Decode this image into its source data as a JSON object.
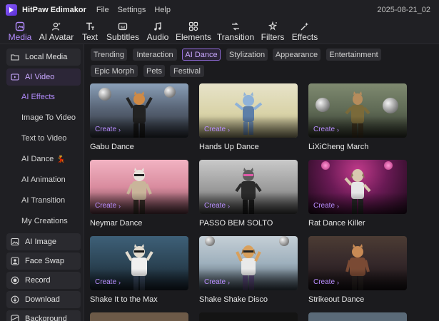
{
  "app": {
    "title": "HitPaw Edimakor",
    "menu": [
      "File",
      "Settings",
      "Help"
    ],
    "date": "2025-08-21_02"
  },
  "tool_tabs": [
    {
      "label": "Media",
      "icon": "media-icon",
      "active": true
    },
    {
      "label": "AI Avatar",
      "icon": "ai-avatar-icon",
      "active": false
    },
    {
      "label": "Text",
      "icon": "text-icon",
      "active": false
    },
    {
      "label": "Subtitles",
      "icon": "subtitles-icon",
      "active": false
    },
    {
      "label": "Audio",
      "icon": "audio-icon",
      "active": false
    },
    {
      "label": "Elements",
      "icon": "elements-icon",
      "active": false
    },
    {
      "label": "Transition",
      "icon": "transition-icon",
      "active": false
    },
    {
      "label": "Filters",
      "icon": "filters-icon",
      "active": false
    },
    {
      "label": "Effects",
      "icon": "effects-icon",
      "active": false
    }
  ],
  "sidebar": {
    "items": [
      {
        "label": "Local Media",
        "icon": "folder-icon",
        "active": false
      },
      {
        "label": "AI Video",
        "icon": "ai-video-icon",
        "active": true
      },
      {
        "label": "AI Image",
        "icon": "ai-image-icon",
        "active": false
      },
      {
        "label": "Face Swap",
        "icon": "face-swap-icon",
        "active": false
      },
      {
        "label": "Record",
        "icon": "record-icon",
        "active": false
      },
      {
        "label": "Download",
        "icon": "download-icon",
        "active": false
      },
      {
        "label": "Background",
        "icon": "background-icon",
        "active": false
      }
    ],
    "sub_items": [
      {
        "label": "AI Effects",
        "active": true
      },
      {
        "label": "Image To Video",
        "active": false
      },
      {
        "label": "Text to Video",
        "active": false
      },
      {
        "label": "AI Dance",
        "active": false,
        "emoji": "💃"
      },
      {
        "label": "AI Animation",
        "active": false
      },
      {
        "label": "AI Transition",
        "active": false
      },
      {
        "label": "My Creations",
        "active": false
      }
    ]
  },
  "categories": [
    {
      "label": "Trending",
      "active": false
    },
    {
      "label": "Interaction",
      "active": false
    },
    {
      "label": "AI Dance",
      "active": true
    },
    {
      "label": "Stylization",
      "active": false
    },
    {
      "label": "Appearance",
      "active": false
    },
    {
      "label": "Entertainment",
      "active": false
    },
    {
      "label": "Epic Morph",
      "active": false
    },
    {
      "label": "Pets",
      "active": false
    },
    {
      "label": "Festival",
      "active": false
    }
  ],
  "create_label": "Create",
  "cards": [
    {
      "title": "Gabu Dance"
    },
    {
      "title": "Hands Up Dance"
    },
    {
      "title": "LiXiCheng March"
    },
    {
      "title": "Neymar Dance"
    },
    {
      "title": "PASSO BEM SOLTO"
    },
    {
      "title": "Rat Dance Killer"
    },
    {
      "title": "Shake It to the Max"
    },
    {
      "title": "Shake Shake Disco"
    },
    {
      "title": "Strikeout Dance"
    }
  ],
  "colors": {
    "accent": "#b48cff",
    "background": "#1b1b1e",
    "panel": "#202024"
  }
}
